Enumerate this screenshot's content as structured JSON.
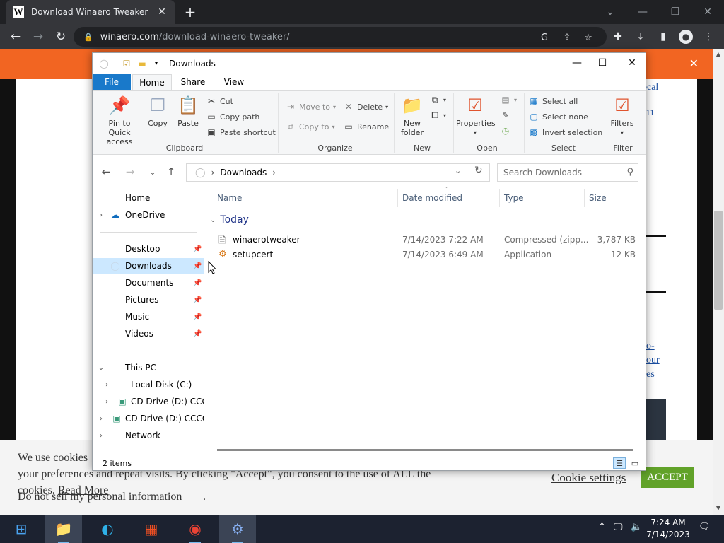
{
  "browser": {
    "tab_title": "Download Winaero Tweaker",
    "favicon_letter": "W",
    "url_host": "winaero.com",
    "url_path": "/download-winaero-tweaker/"
  },
  "page": {
    "sidebar_snippets": [
      "ocal",
      "rs 11",
      "o-",
      "our",
      "es"
    ],
    "cookie": {
      "line1": "We use cookies",
      "line2": "your preferences and repeat visits. By clicking \"Accept\", you consent to the use of ALL the",
      "line3_prefix": "cookies.",
      "read_more": "Read More",
      "do_not_sell": "Do not sell my personal information",
      "settings": "Cookie settings",
      "accept": "ACCEPT"
    }
  },
  "explorer": {
    "title": "Downloads",
    "ribbon_tabs": [
      "File",
      "Home",
      "Share",
      "View"
    ],
    "clipboard": {
      "pin": "Pin to Quick access",
      "copy": "Copy",
      "paste": "Paste",
      "cut": "Cut",
      "copy_path": "Copy path",
      "paste_shortcut": "Paste shortcut",
      "label": "Clipboard"
    },
    "organize": {
      "move_to": "Move to",
      "copy_to": "Copy to",
      "delete": "Delete",
      "rename": "Rename",
      "label": "Organize"
    },
    "new_group": {
      "new_folder": "New folder",
      "label": "New"
    },
    "open_group": {
      "properties": "Properties",
      "label": "Open"
    },
    "select_group": {
      "select_all": "Select all",
      "select_none": "Select none",
      "invert": "Invert selection",
      "label": "Select"
    },
    "filter_group": {
      "filters": "Filters",
      "label": "Filter"
    },
    "address": {
      "crumb": "Downloads",
      "search_placeholder": "Search Downloads"
    },
    "nav": {
      "home": "Home",
      "onedrive": "OneDrive",
      "desktop": "Desktop",
      "downloads": "Downloads",
      "documents": "Documents",
      "pictures": "Pictures",
      "music": "Music",
      "videos": "Videos",
      "this_pc": "This PC",
      "local_disk": "Local Disk (C:)",
      "cd_drive_1": "CD Drive (D:) CCCC",
      "cd_drive_2": "CD Drive (D:) CCCOM",
      "network": "Network"
    },
    "columns": {
      "name": "Name",
      "date": "Date modified",
      "type": "Type",
      "size": "Size"
    },
    "group_today": "Today",
    "files": [
      {
        "name": "winaerotweaker",
        "date": "7/14/2023 7:22 AM",
        "type": "Compressed (zipp...",
        "size": "3,787 KB"
      },
      {
        "name": "setupcert",
        "date": "7/14/2023 6:49 AM",
        "type": "Application",
        "size": "12 KB"
      }
    ],
    "status": "2 items"
  },
  "taskbar": {
    "time": "7:24 AM",
    "date": "7/14/2023"
  },
  "colors": {
    "orange_banner": "#f26522",
    "accept_green": "#61a229",
    "file_tab_blue": "#1979ca",
    "nav_selected": "#cce8ff"
  }
}
